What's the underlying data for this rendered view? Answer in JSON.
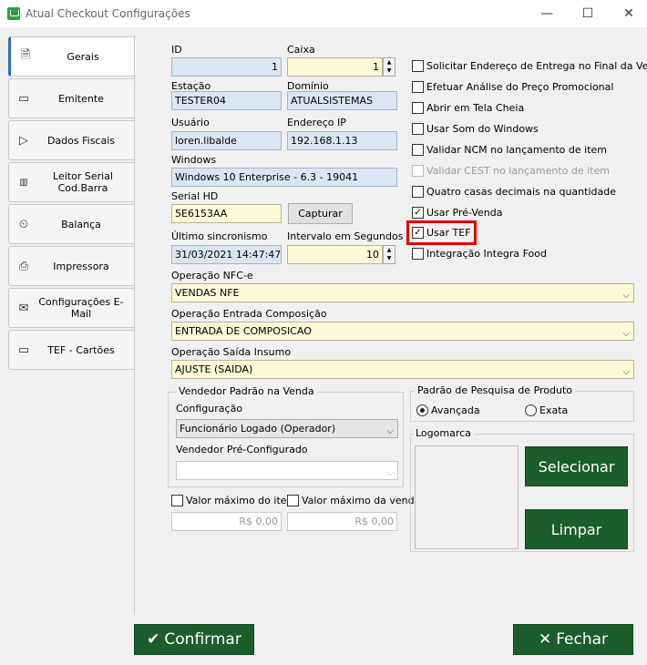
{
  "window": {
    "title": "Atual Checkout Configurações",
    "minimize": "—",
    "maximize": "☐",
    "close": "✕"
  },
  "tabs": [
    {
      "label": "Gerais",
      "icon": "document-icon"
    },
    {
      "label": "Emitente",
      "icon": "card-icon"
    },
    {
      "label": "Dados Fiscais",
      "icon": "flag-icon"
    },
    {
      "label": "Leitor Serial Cod.Barra",
      "icon": "barcode-icon"
    },
    {
      "label": "Balança",
      "icon": "scale-icon"
    },
    {
      "label": "Impressora",
      "icon": "printer-icon"
    },
    {
      "label": "Configurações E-Mail",
      "icon": "mail-icon"
    },
    {
      "label": "TEF - Cartões",
      "icon": "card-icon"
    }
  ],
  "fields": {
    "id": {
      "label": "ID",
      "value": "1"
    },
    "caixa": {
      "label": "Caixa",
      "value": "1"
    },
    "estacao": {
      "label": "Estação",
      "value": "TESTER04"
    },
    "dominio": {
      "label": "Domínio",
      "value": "ATUALSISTEMAS"
    },
    "usuario": {
      "label": "Usuário",
      "value": "loren.libalde"
    },
    "endereco_ip": {
      "label": "Endereço IP",
      "value": "192.168.1.13"
    },
    "windows": {
      "label": "Windows",
      "value": "Windows 10 Enterprise - 6.3 - 19041"
    },
    "serial_hd": {
      "label": "Serial HD",
      "value": "5E6153AA"
    },
    "capturar": "Capturar",
    "ultimo_sincronismo": {
      "label": "Último sincronismo",
      "value": "31/03/2021 14:47:47"
    },
    "intervalo": {
      "label": "Intervalo em Segundos",
      "value": "10"
    }
  },
  "checkboxes": [
    {
      "label": "Solicitar Endereço de Entrega no Final da Venda",
      "checked": false
    },
    {
      "label": "Efetuar Análise do Preço Promocional",
      "checked": false
    },
    {
      "label": "Abrir em Tela Cheia",
      "checked": false
    },
    {
      "label": "Usar Som do Windows",
      "checked": false
    },
    {
      "label": "Validar NCM no lançamento de item",
      "checked": false
    },
    {
      "label": "Validar CEST no lançamento de item",
      "checked": false,
      "disabled": true
    },
    {
      "label": "Quatro casas decimais na quantidade",
      "checked": false
    },
    {
      "label": "Usar Pré-Venda",
      "checked": true
    },
    {
      "label": "Usar TEF",
      "checked": true,
      "highlighted": true
    },
    {
      "label": "Integração Integra Food",
      "checked": false
    }
  ],
  "operations": {
    "nfce": {
      "label": "Operação NFC-e",
      "value": "VENDAS NFE"
    },
    "entrada": {
      "label": "Operação Entrada Composição",
      "value": "ENTRADA DE COMPOSICAO"
    },
    "saida": {
      "label": "Operação Saída Insumo",
      "value": "AJUSTE (SAIDA)"
    }
  },
  "vendedor": {
    "group_title": "Vendedor Padrão na Venda",
    "config_label": "Configuração",
    "config_value": "Funcionário Logado (Operador)",
    "preconf_label": "Vendedor Pré-Configurado",
    "preconf_value": ""
  },
  "valores": {
    "item_label": "Valor máximo do item",
    "item_value": "R$ 0,00",
    "venda_label": "Valor máximo da venda",
    "venda_value": "R$ 0,00"
  },
  "pesquisa": {
    "group_title": "Padrão de Pesquisa de Produto",
    "avancada": "Avançada",
    "exata": "Exata",
    "selected": "avancada"
  },
  "logomarca": {
    "group_title": "Logomarca",
    "selecionar": "Selecionar",
    "limpar": "Limpar"
  },
  "footer": {
    "confirmar": "Confirmar",
    "fechar": "Fechar"
  },
  "colors": {
    "accent_green": "#1b5e2b",
    "highlight_red": "#e00000",
    "tab_accent": "#2a6fb5"
  }
}
